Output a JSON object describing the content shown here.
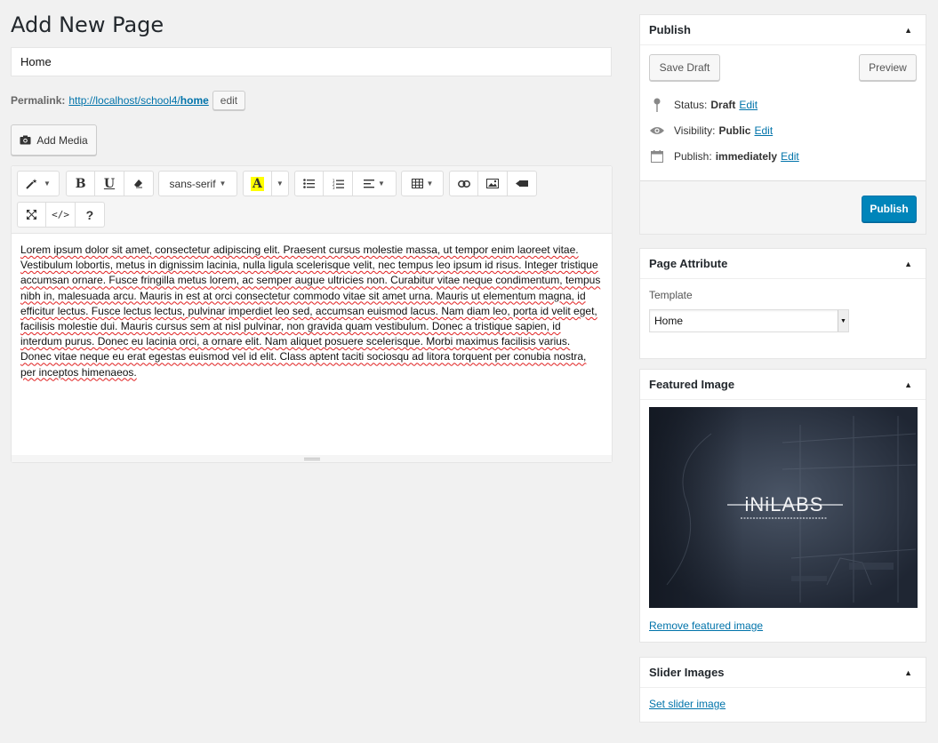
{
  "page": {
    "title": "Add New Page",
    "post_title": "Home"
  },
  "permalink": {
    "label": "Permalink:",
    "url_base": "http://localhost/school4/",
    "slug": "home",
    "edit_label": "edit"
  },
  "media": {
    "add_label": "Add Media"
  },
  "toolbar": {
    "font_family": "sans-serif",
    "help_label": "?"
  },
  "editor": {
    "content": "Lorem ipsum dolor sit amet, consectetur adipiscing elit. Praesent cursus molestie massa, ut tempor enim laoreet vitae. Vestibulum lobortis, metus in dignissim lacinia, nulla ligula scelerisque velit, nec tempus leo ipsum id risus. Integer tristique accumsan ornare. Fusce fringilla metus lorem, ac semper augue ultricies non. Curabitur vitae neque condimentum, tempus nibh in, malesuada arcu. Mauris in est at orci consectetur commodo vitae sit amet urna. Mauris ut elementum magna, id efficitur lectus. Fusce lectus lectus, pulvinar imperdiet leo sed, accumsan euismod lacus. Nam diam leo, porta id velit eget, facilisis molestie dui. Mauris cursus sem at nisl pulvinar, non gravida quam vestibulum. Donec a tristique sapien, id interdum purus. Donec eu lacinia orci, a ornare elit. Nam aliquet posuere scelerisque. Morbi maximus facilisis varius. Donec vitae neque eu erat egestas euismod vel id elit. Class aptent taciti sociosqu ad litora torquent per conubia nostra, per inceptos himenaeos."
  },
  "publish_box": {
    "title": "Publish",
    "save_draft": "Save Draft",
    "preview": "Preview",
    "status_label": "Status:",
    "status_value": "Draft",
    "visibility_label": "Visibility:",
    "visibility_value": "Public",
    "publish_label": "Publish:",
    "publish_value": "immediately",
    "edit_link": "Edit",
    "publish_button": "Publish"
  },
  "attributes_box": {
    "title": "Page Attribute",
    "template_label": "Template",
    "template_value": "Home"
  },
  "featured_box": {
    "title": "Featured Image",
    "logo_text": "iNiLABS",
    "remove_link": "Remove featured image"
  },
  "slider_box": {
    "title": "Slider Images",
    "set_link": "Set slider image"
  },
  "colors": {
    "accent": "#0085ba",
    "link": "#0073aa",
    "background": "#f1f1f1"
  },
  "icons": [
    "magic-wand-icon",
    "bold-icon",
    "underline-icon",
    "eraser-icon",
    "highlight-color-icon",
    "bullet-list-icon",
    "numbered-list-icon",
    "align-icon",
    "table-icon",
    "link-icon",
    "image-icon",
    "video-icon",
    "fullscreen-icon",
    "code-view-icon",
    "help-icon",
    "camera-icon",
    "pin-icon",
    "eye-icon",
    "calendar-icon",
    "collapse-arrow-icon"
  ]
}
